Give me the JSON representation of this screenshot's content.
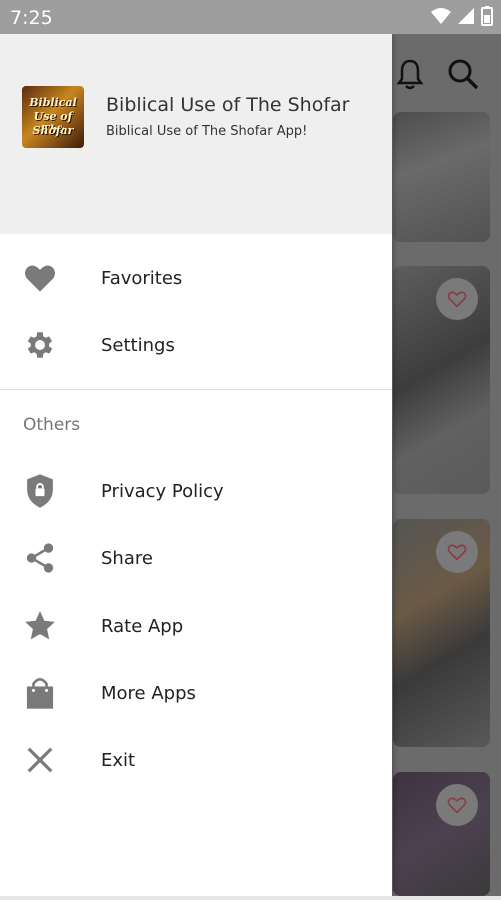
{
  "status_bar": {
    "time": "7:25"
  },
  "drawer": {
    "app_title": "Biblical Use of The Shofar",
    "app_subtitle": "Biblical Use of The Shofar App!",
    "logo_text": [
      "Biblical",
      "Use of The",
      "Shofar"
    ],
    "items": [
      {
        "label": "Favorites",
        "icon": "heart-icon"
      },
      {
        "label": "Settings",
        "icon": "gear-icon"
      }
    ],
    "section_label": "Others",
    "others": [
      {
        "label": "Privacy Policy",
        "icon": "shield-lock-icon"
      },
      {
        "label": "Share",
        "icon": "share-icon"
      },
      {
        "label": "Rate App",
        "icon": "star-icon"
      },
      {
        "label": "More Apps",
        "icon": "shopping-bag-icon"
      },
      {
        "label": "Exit",
        "icon": "close-icon"
      }
    ]
  },
  "colors": {
    "icon_gray": "#7a7a7a",
    "header_bg": "#efefef",
    "scrim": "#6b6b6b",
    "status_bar": "#9e9e9e"
  }
}
